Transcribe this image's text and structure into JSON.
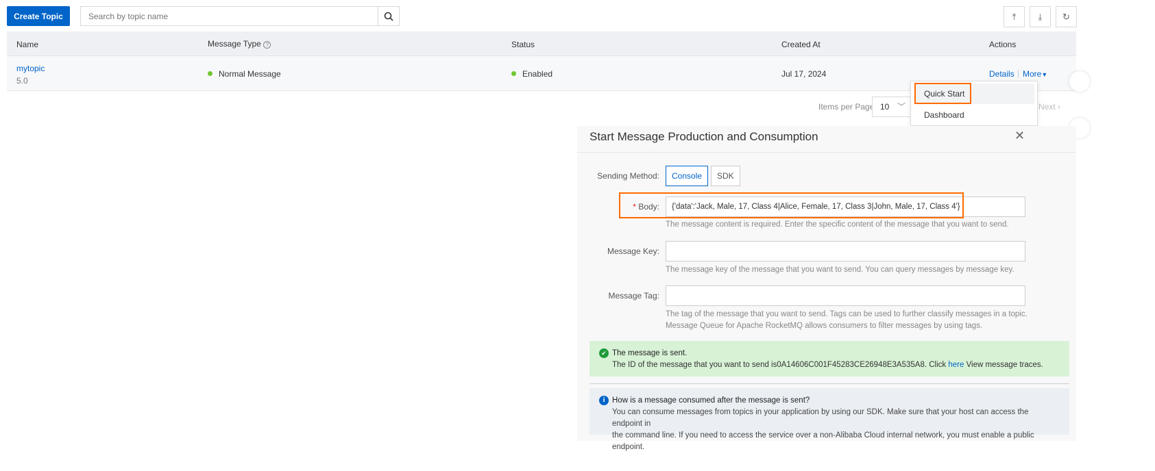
{
  "toolbar": {
    "create_label": "Create Topic",
    "search_placeholder": "Search by topic name"
  },
  "icons": {
    "search": "search-icon",
    "upload": "upload-icon",
    "download": "download-icon",
    "refresh": "refresh-icon"
  },
  "table": {
    "headers": {
      "name": "Name",
      "type": "Message Type",
      "status": "Status",
      "created": "Created At",
      "actions": "Actions"
    },
    "rows": [
      {
        "name": "mytopic",
        "version": "5.0",
        "type": "Normal Message",
        "status": "Enabled",
        "created": "Jul 17, 2024",
        "details": "Details",
        "more": "More"
      }
    ]
  },
  "pagination": {
    "items_per_page": "Items per Page",
    "page_size": "10",
    "next": "Next"
  },
  "dropdown": {
    "items": [
      "Quick Start",
      "Dashboard"
    ]
  },
  "panel": {
    "title": "Start Message Production and Consumption",
    "sending_method_label": "Sending Method:",
    "methods": [
      "Console",
      "SDK"
    ],
    "body_required": "*",
    "body_label": "Body:",
    "body_value": "{'data':'Jack, Male, 17, Class 4|Alice, Female, 17, Class 3|John, Male, 17, Class 4'}",
    "body_help": "The message content is required. Enter the specific content of the message that you want to send.",
    "key_label": "Message Key:",
    "key_value": "",
    "key_help": "The message key of the message that you want to send. You can query messages by message key.",
    "tag_label": "Message Tag:",
    "tag_value": "",
    "tag_help1": "The tag of the message that you want to send. Tags can be used to further classify messages in a topic.",
    "tag_help2": "Message Queue for Apache RocketMQ allows consumers to filter messages by using tags.",
    "success_title": "The message is sent.",
    "success_text1": "The ID of the message that you want to send is0A14606C001F45283CE26948E3A535A8. Click ",
    "success_link": "here",
    "success_text2": " View message traces.",
    "info_title": "How is a message consumed after the message is sent?",
    "info_text1": "You can consume messages from topics in your application by using our SDK. Make sure that your host can access the endpoint in",
    "info_text2": "the command line. If you need to access the service over a non-Alibaba Cloud internal network, you must enable a public endpoint."
  },
  "colors": {
    "primary": "#0064c8",
    "highlight": "#ff6a00",
    "success_bg": "#d8f2d6",
    "info_bg": "#ebeff4",
    "status_green": "#6fc630"
  }
}
